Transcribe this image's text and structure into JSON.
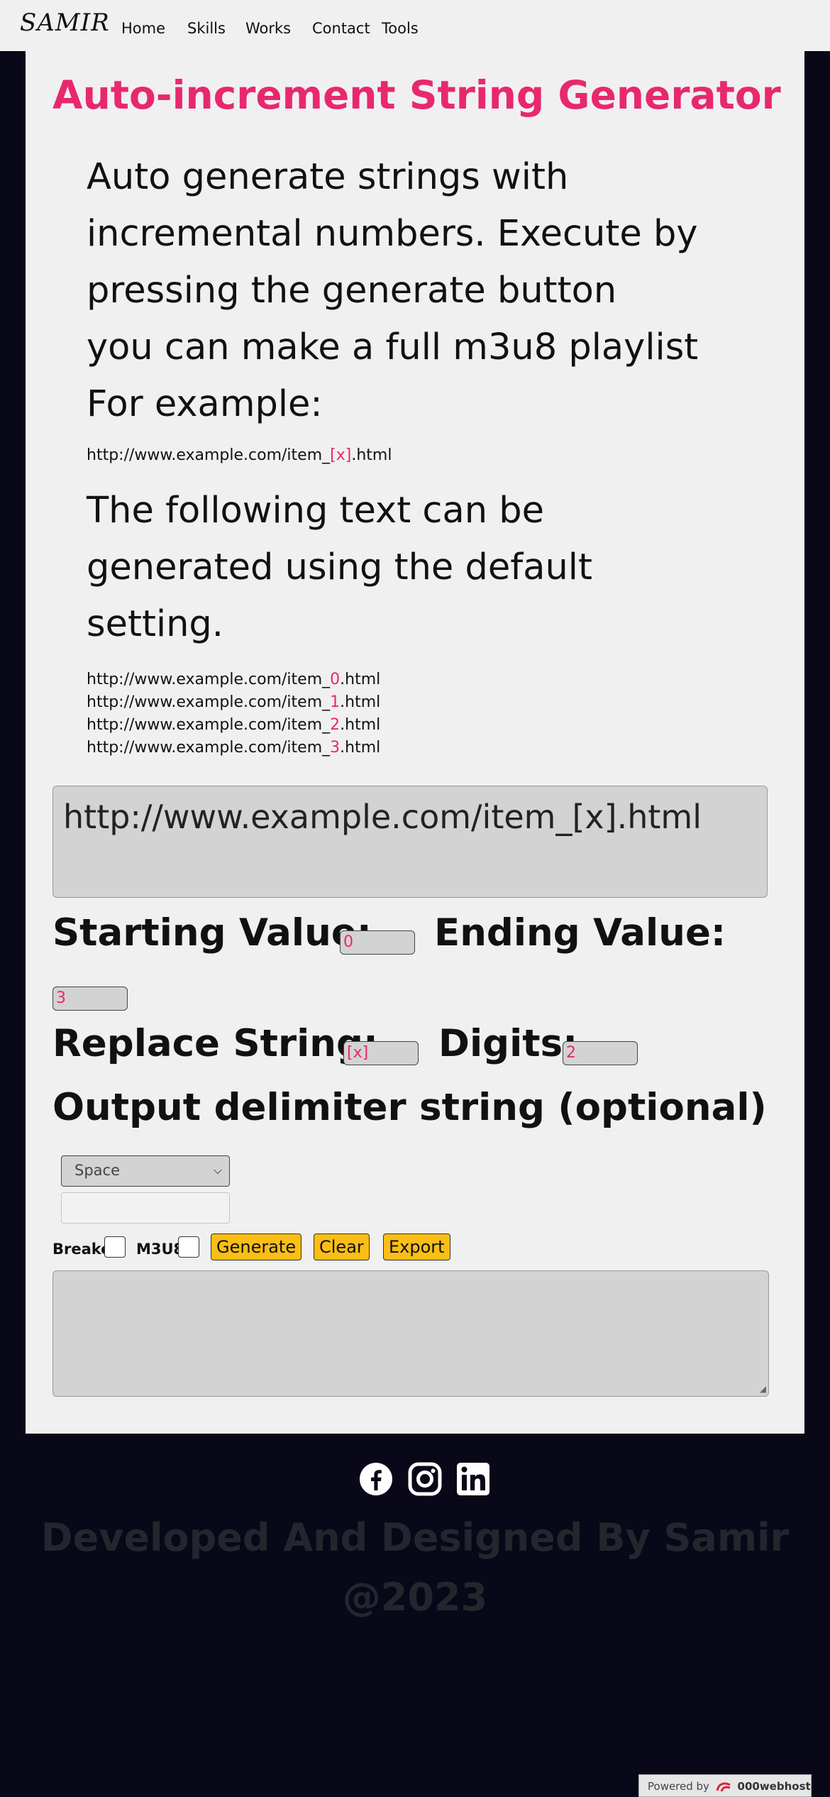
{
  "nav": {
    "logo": "SAMIR",
    "links": [
      "Home",
      "Skills",
      "Works",
      "Contact",
      "Tools"
    ]
  },
  "page": {
    "title": "Auto-increment String Generator",
    "intro_lines": [
      "Auto generate strings with",
      "incremental numbers. Execute by",
      "pressing the generate button",
      "you can make a full m3u8 playlist",
      "For example:"
    ],
    "example_url": {
      "prefix": "http://www.example.com/item_",
      "token": "[x]",
      "suffix": ".html"
    },
    "following_lines": [
      "The following text can be",
      "generated using the default",
      "setting."
    ],
    "generated": {
      "prefix": "http://www.example.com/item_",
      "suffix": ".html",
      "numbers": [
        "0",
        "1",
        "2",
        "3"
      ]
    }
  },
  "form": {
    "template": "http://www.example.com/item_[x].html",
    "starting_label": "Starting Value:",
    "starting_value": "0",
    "ending_label": "Ending Value:",
    "ending_value": "3",
    "replace_label": "Replace String:",
    "replace_value": "[x]",
    "digits_label": "Digits:",
    "digits_value": "2",
    "delimiter_label": "Output delimiter string (optional)",
    "delimiter_selected": "Space",
    "break_label": "Breake:",
    "m3u8_label": "M3U8:",
    "generate_label": "Generate",
    "clear_label": "Clear",
    "export_label": "Export"
  },
  "footer": {
    "social_icons": [
      "facebook-icon",
      "instagram-icon",
      "linkedin-icon"
    ],
    "credit_line1": "Developed And Designed By Samir",
    "credit_line2": "@2023"
  },
  "badge": {
    "powered": "Powered by",
    "brand": "000webhost"
  },
  "colors": {
    "accent": "#e8286e",
    "button": "#fbbe15",
    "background": "#080818",
    "card": "#f0f0f0"
  }
}
